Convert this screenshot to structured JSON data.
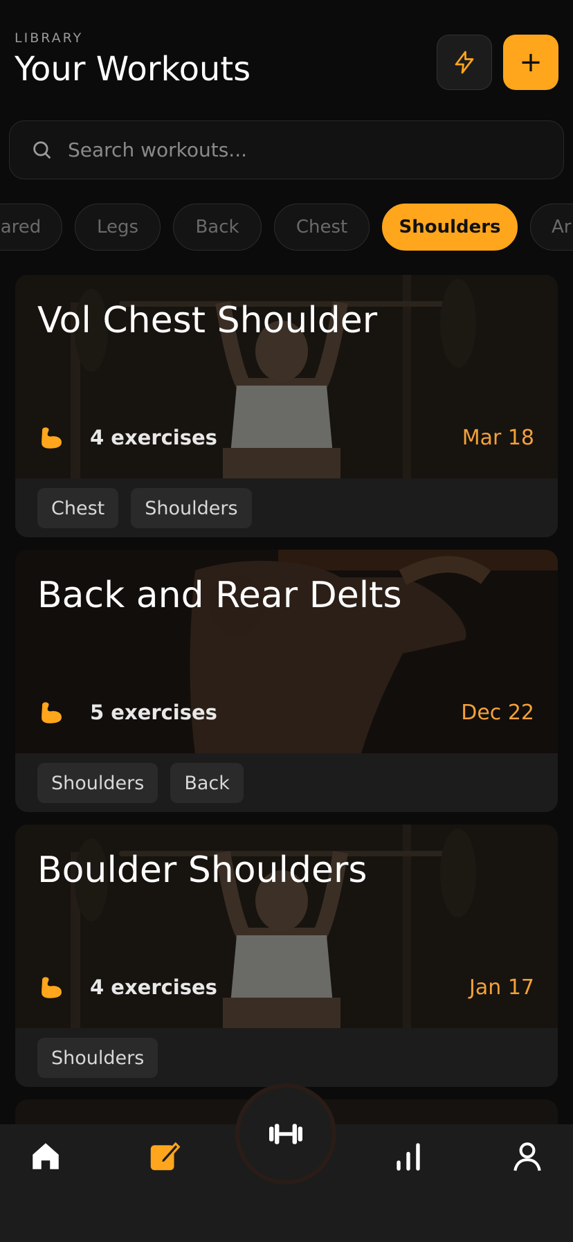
{
  "header": {
    "eyebrow": "LIBRARY",
    "title": "Your Workouts"
  },
  "icons": {
    "quick": "lightning-icon",
    "add": "plus-icon",
    "search": "search-icon",
    "muscle": "flexed-bicep-icon"
  },
  "colors": {
    "accent": "#ffa61c",
    "background": "#0b0b0b",
    "card": "#1c1c1c",
    "date": "#f2a13b"
  },
  "add_button": {
    "label": "+"
  },
  "search": {
    "placeholder": "Search workouts..."
  },
  "filters": [
    {
      "label": "ared",
      "active": false
    },
    {
      "label": "Legs",
      "active": false
    },
    {
      "label": "Back",
      "active": false
    },
    {
      "label": "Chest",
      "active": false
    },
    {
      "label": "Shoulders",
      "active": true
    },
    {
      "label": "Ar",
      "active": false
    }
  ],
  "workouts": [
    {
      "title": "Vol Chest Shoulder",
      "exercises": "4 exercises",
      "date": "Mar 18",
      "tags": [
        "Chest",
        "Shoulders"
      ]
    },
    {
      "title": "Back and Rear Delts",
      "exercises": "5 exercises",
      "date": "Dec 22",
      "tags": [
        "Shoulders",
        "Back"
      ]
    },
    {
      "title": "Boulder Shoulders",
      "exercises": "4 exercises",
      "date": "Jan 17",
      "tags": [
        "Shoulders"
      ]
    }
  ],
  "nav": {
    "items": [
      "home-icon",
      "edit-icon",
      "dumbbell-icon",
      "stats-icon",
      "profile-icon"
    ],
    "active": "edit-icon"
  }
}
